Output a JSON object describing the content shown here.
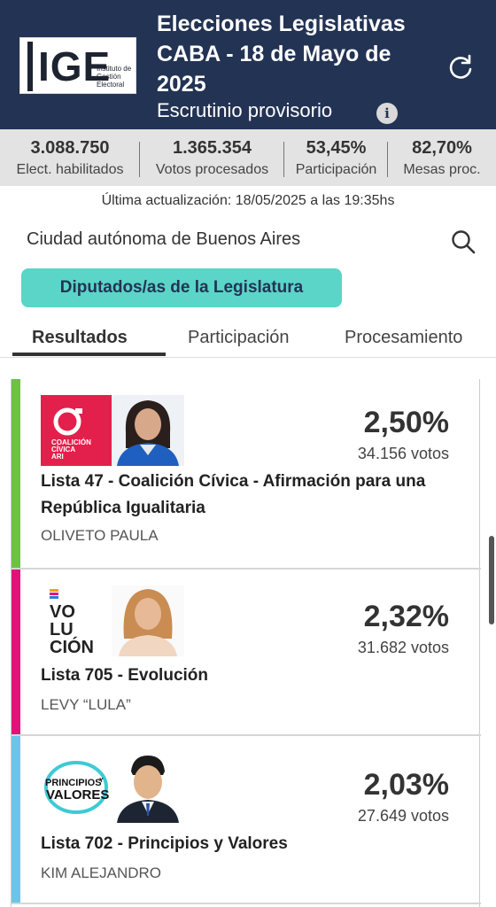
{
  "header": {
    "logo_text": "IGE",
    "logo_subtext": "Instituto de Gestión Electoral",
    "title": "Elecciones Legislativas CABA - 18 de Mayo de 2025",
    "subtitle": "Escrutinio provisorio",
    "info_icon": "i",
    "refresh_icon": "refresh-icon",
    "bg_color": "#233354"
  },
  "stats": [
    {
      "value": "3.088.750",
      "label": "Elect. habilitados"
    },
    {
      "value": "1.365.354",
      "label": "Votos procesados"
    },
    {
      "value": "53,45%",
      "label": "Participación"
    },
    {
      "value": "82,70%",
      "label": "Mesas proc."
    }
  ],
  "updated": "Última actualización: 18/05/2025 a las 19:35hs",
  "region": "Ciudad autónoma de Buenos Aires",
  "chip": {
    "label": "Diputados/as de la Legislatura",
    "color": "#5bd5c7"
  },
  "tabs": [
    {
      "label": "Resultados",
      "active": true
    },
    {
      "label": "Participación",
      "active": false
    },
    {
      "label": "Procesamiento",
      "active": false
    }
  ],
  "results": [
    {
      "percent": "2,50%",
      "votes": "34.156 votos",
      "name": "Lista 47 - Coalición Cívica - Afirmación para una República Igualitaria",
      "candidate": "OLIVETO PAULA",
      "color": "#6dc145",
      "logo_text": "COALICIÓN CÍVICA ARI",
      "logo_bg": "#e3204b"
    },
    {
      "percent": "2,32%",
      "votes": "31.682 votos",
      "name": "Lista 705 - Evolución",
      "candidate": "LEVY “LULA”",
      "color": "#e2127a",
      "logo_text": "VO LU CIÓN",
      "logo_bg": "#ffffff"
    },
    {
      "percent": "2,03%",
      "votes": "27.649 votos",
      "name": "Lista 702 - Principios y Valores",
      "candidate": "KIM ALEJANDRO",
      "color": "#6cc5e8",
      "logo_text": "PRINCIPIOS Y VALORES",
      "logo_bg": "#ffffff"
    }
  ]
}
